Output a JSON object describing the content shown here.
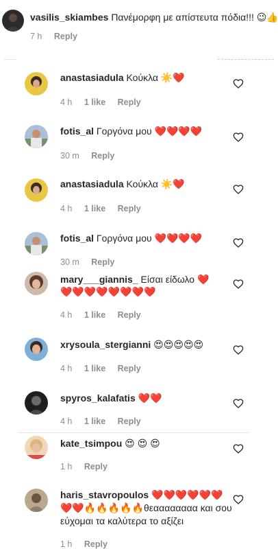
{
  "colors": {
    "text": "#262626",
    "muted": "#8e8e8e",
    "background": "#ffffff"
  },
  "top_comment": {
    "user": "vasilis_skiambes",
    "text": "Πανέμορφη με απίστευτα πόδια!!! 😉👍",
    "time": "7 h",
    "reply": "Reply"
  },
  "replies": [
    {
      "user": "anastasiadula",
      "text": "Κούκλα ☀️❤️",
      "time": "4 h",
      "likes": "1 like",
      "reply": "Reply"
    },
    {
      "user": "fotis_al",
      "text": "Γοργόνα μου ❤️❤️❤️❤️",
      "time": "30 m",
      "reply": "Reply"
    },
    {
      "user": "anastasiadula",
      "text": "Κούκλα ☀️❤️",
      "time": "4 h",
      "likes": "1 like",
      "reply": "Reply"
    },
    {
      "user": "fotis_al",
      "text": "Γοργόνα μου ❤️❤️❤️❤️",
      "time": "30 m",
      "reply": "Reply"
    },
    {
      "user": "mary___giannis_",
      "text": "Είσαι είδωλο ❤️",
      "text_line2": "❤️❤️❤️❤️❤️❤️❤️❤️",
      "time": "4 h",
      "likes": "1 like",
      "reply": "Reply"
    },
    {
      "user": "xrysoula_stergianni",
      "text": "😍😍😍😍😍",
      "time": "4 h",
      "likes": "1 like",
      "reply": "Reply"
    },
    {
      "user": "spyros_kalafatis",
      "text": "❤️❤️",
      "time": "4 h",
      "likes": "1 like",
      "reply": "Reply"
    },
    {
      "user": "kate_tsimpou",
      "text": "😍 😍 😍",
      "time": "1 h",
      "reply": "Reply"
    },
    {
      "user": "haris_stavropoulos",
      "text": "❤️❤️❤️❤️❤️❤️",
      "text_line2": "❤️❤️🔥🔥🔥🔥🔥θεαααααααα και σου",
      "text_line3": "εύχομαι τα καλύτερα το αξίζει",
      "time": "1 h",
      "reply": "Reply"
    }
  ]
}
